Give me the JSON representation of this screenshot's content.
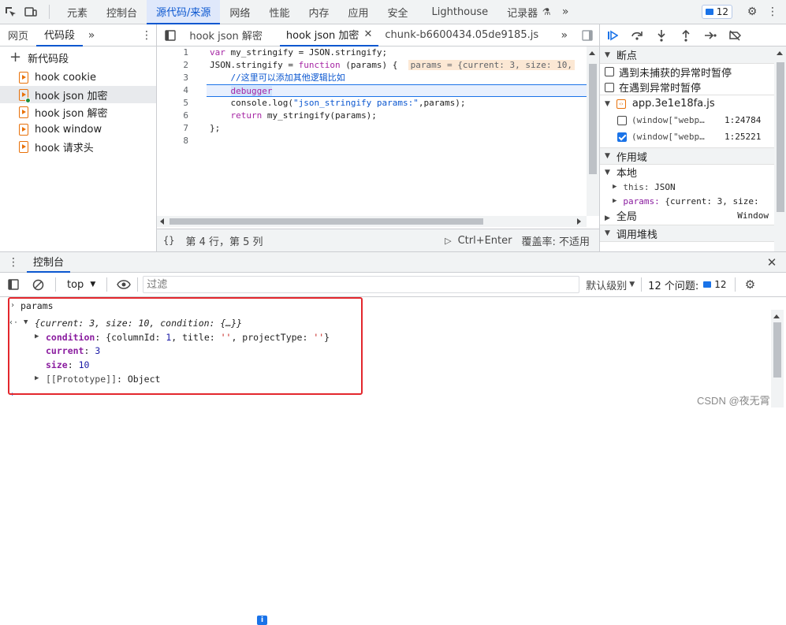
{
  "top_tabs": [
    "元素",
    "控制台",
    "源代码/来源",
    "网络",
    "性能",
    "内存",
    "应用",
    "安全",
    "Lighthouse",
    "记录器"
  ],
  "top_active": "源代码/来源",
  "issues_badge": "12",
  "left_tabs": [
    "网页",
    "代码段"
  ],
  "new_snippet": "新代码段",
  "snippets": [
    "hook cookie",
    "hook json 加密",
    "hook json 解密",
    "hook window",
    "hook 请求头"
  ],
  "editor_tabs": [
    "hook json 解密",
    "hook json 加密",
    "chunk-b6600434.05de9185.js"
  ],
  "line_numbers": [
    "1",
    "2",
    "3",
    "4",
    "5",
    "6",
    "7",
    "8"
  ],
  "code": {
    "l1_kw": "var",
    "l1_rest": " my_stringify = JSON.stringify;",
    "l2_a": "JSON.stringify = ",
    "l2_kw": "function",
    "l2_b": " (params) {  ",
    "l2_inline": "params = {current: 3, size: 10,",
    "l3": "    //这里可以添加其他逻辑比如",
    "l4": "debugger",
    "l5_a": "    console.log(",
    "l5_str": "\"json_stringify params:\"",
    "l5_b": ",params);",
    "l6_kw": "    return",
    "l6_rest": " my_stringify(params);",
    "l7": "};"
  },
  "status": {
    "position": "第 4 行，第 5 列",
    "run": "Ctrl+Enter",
    "coverage": "覆盖率: 不适用"
  },
  "breakpoints": {
    "title": "断点",
    "pause_uncaught": "遇到未捕获的异常时暂停",
    "pause_caught": "在遇到异常时暂停",
    "file": "app.3e1e18fa.js",
    "items": [
      {
        "code": "(window[\"webp…",
        "loc": "1:24784",
        "checked": false
      },
      {
        "code": "(window[\"webp…",
        "loc": "1:25221",
        "checked": true
      }
    ]
  },
  "scope": {
    "title": "作用域",
    "local": "本地",
    "this_label": "this:",
    "this_val": "JSON",
    "params_label": "params:",
    "params_val": "{current: 3, size:",
    "global": "全局",
    "global_val": "Window"
  },
  "callstack_title": "调用堆栈",
  "console": {
    "title": "控制台",
    "context": "top",
    "filter_placeholder": "过滤",
    "levels": "默认级别",
    "issues_text": "12 个问题:",
    "issues_count": "12",
    "input": "params",
    "obj_summary": "{current: 3, size: 10, condition: {…}}",
    "cond_label": "condition",
    "cond_a": "{columnId: ",
    "cond_n": "1",
    "cond_b": ", title: ",
    "cond_s1": "''",
    "cond_c": ", projectType: ",
    "cond_s2": "''",
    "cond_d": "}",
    "current_label": "current",
    "current_val": "3",
    "size_label": "size",
    "size_val": "10",
    "proto_label": "[[Prototype]]",
    "proto_val": "Object"
  },
  "watermark": "CSDN @夜无霄",
  "colors": {
    "accent": "#0b57d0",
    "annotation_box": "#e3272d"
  }
}
